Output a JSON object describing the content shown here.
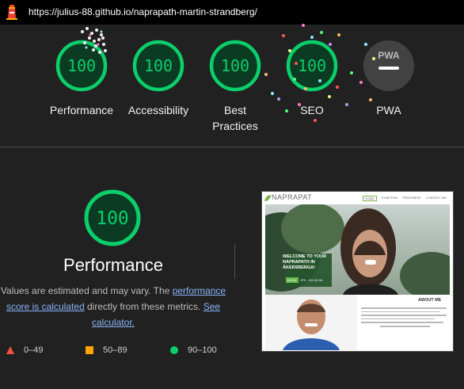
{
  "header": {
    "url": "https://julius-88.github.io/naprapath-martin-strandberg/"
  },
  "gauges": [
    {
      "label": "Performance",
      "score": "100",
      "value": 100
    },
    {
      "label": "Accessibility",
      "score": "100",
      "value": 100
    },
    {
      "label": "Best Practices",
      "score": "100",
      "value": 100
    },
    {
      "label": "SEO",
      "score": "100",
      "value": 100
    },
    {
      "label": "PWA",
      "badge": "PWA"
    }
  ],
  "performance": {
    "score": "100",
    "title": "Performance",
    "desc_prefix": "Values are estimated and may vary. The ",
    "desc_link": "performance score is calculated",
    "desc_middle": " directly from these metrics. ",
    "calc_link": "See calculator."
  },
  "legend": [
    {
      "range": "0–49",
      "shape": "triangle",
      "color": "#ff4e42"
    },
    {
      "range": "50–89",
      "shape": "square",
      "color": "#ffa400"
    },
    {
      "range": "90–100",
      "shape": "circle",
      "color": "#0cce6b"
    }
  ],
  "thumbnail": {
    "logo": "NAPRAPAT",
    "nav": [
      "HOME",
      "SYMPTOM",
      "TREATMENT",
      "CONTACT ME"
    ],
    "hero_title": "WELCOME TO YOUR NAPRAPATH IN ÅKERSBERGA!",
    "hero_btn": "BOOK",
    "hero_phone": "070 - 411 60 84",
    "about_title": "ABOUT ME"
  },
  "colors": {
    "pass": "#0cce6b",
    "pass_bg": "#0b3b22",
    "background": "#212121",
    "link": "#8ab4f8"
  }
}
